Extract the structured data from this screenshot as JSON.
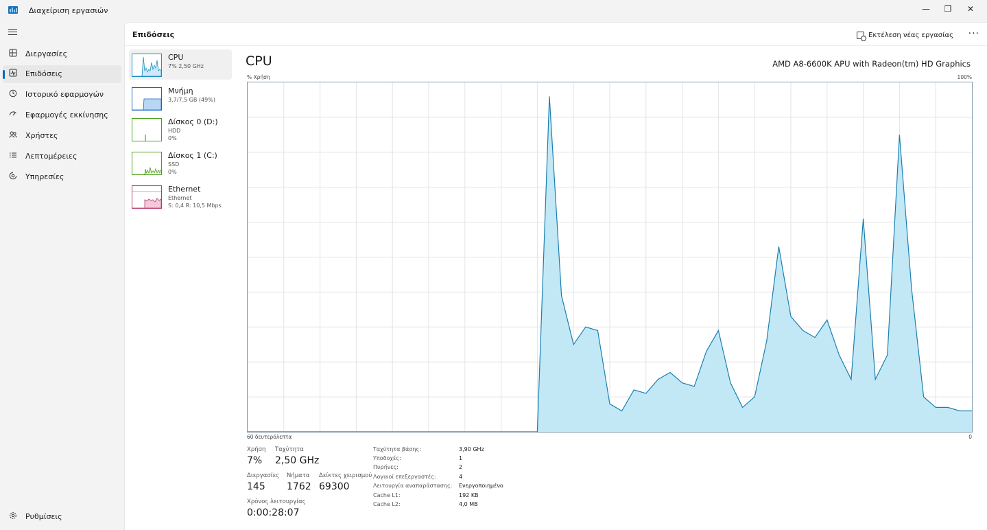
{
  "app": {
    "title": "Διαχείριση εργασιών",
    "window_controls": {
      "minimize": "—",
      "maximize": "❐",
      "close": "✕"
    }
  },
  "nav": {
    "items": [
      {
        "label": "Διεργασίες",
        "icon": "grid-icon"
      },
      {
        "label": "Επιδόσεις",
        "icon": "performance-icon",
        "active": true
      },
      {
        "label": "Ιστορικό εφαρμογών",
        "icon": "history-icon"
      },
      {
        "label": "Εφαρμογές εκκίνησης",
        "icon": "startup-icon"
      },
      {
        "label": "Χρήστες",
        "icon": "users-icon"
      },
      {
        "label": "Λεπτομέρειες",
        "icon": "details-icon"
      },
      {
        "label": "Υπηρεσίες",
        "icon": "services-icon"
      }
    ],
    "settings": {
      "label": "Ρυθμίσεις",
      "icon": "settings-icon"
    }
  },
  "header": {
    "title": "Επιδόσεις",
    "run_task_label": "Εκτέλεση νέας εργασίας",
    "more_label": "···"
  },
  "devices": [
    {
      "name": "CPU",
      "line1": "7% 2,50 GHz",
      "line2": "",
      "color": "#1b8fc7",
      "fill": "#cfe9f7",
      "active": true
    },
    {
      "name": "Μνήμη",
      "line1": "3,7/7,5 GB (49%)",
      "line2": "",
      "color": "#1b63c7",
      "fill": "#b8d7f4"
    },
    {
      "name": "Δίσκος 0 (D:)",
      "line1": "HDD",
      "line2": "0%",
      "color": "#4b9e1b",
      "fill": "#d6efc4"
    },
    {
      "name": "Δίσκος 1 (C:)",
      "line1": "SSD",
      "line2": "0%",
      "color": "#4b9e1b",
      "fill": "#d6efc4"
    },
    {
      "name": "Ethernet",
      "line1": "Ethernet",
      "line2": "S: 0,4 R: 10,5 Mbps",
      "color": "#b23a6b",
      "fill": "#f5c8d9"
    }
  ],
  "cpu": {
    "title": "CPU",
    "model": "AMD A8-6600K APU with Radeon(tm) HD Graphics",
    "y_label": "% Χρήση",
    "y_max_label": "100%",
    "x_left_label": "60 δευτερόλεπτα",
    "x_right_label": "0",
    "line_color": "#1b7fb0",
    "fill_color": "#c2e8f6",
    "grid_color": "#e3e3e3"
  },
  "chart_data": {
    "type": "area",
    "title": "",
    "xlabel": "60 δευτερόλεπτα",
    "ylabel": "% Χρήση",
    "xlim": [
      60,
      0
    ],
    "ylim": [
      0,
      100
    ],
    "grid": true,
    "series": [
      {
        "x": [
          60,
          59,
          58,
          57,
          56,
          55,
          54,
          53,
          52,
          51,
          50,
          49,
          48,
          47,
          46,
          45,
          44,
          43,
          42,
          41,
          40,
          39,
          38,
          37,
          36,
          35,
          34,
          33,
          32,
          31,
          30,
          29,
          28,
          27,
          26,
          25,
          24,
          23,
          22,
          21,
          20,
          19,
          18,
          17,
          16,
          15,
          14,
          13,
          12,
          11,
          10,
          9,
          8,
          7,
          6,
          5,
          4,
          3,
          2,
          1,
          0
        ],
        "values": [
          0,
          0,
          0,
          0,
          0,
          0,
          0,
          0,
          0,
          0,
          0,
          0,
          0,
          0,
          0,
          0,
          0,
          0,
          0,
          0,
          0,
          0,
          0,
          0,
          0,
          96,
          39,
          25,
          30,
          29,
          8,
          6,
          12,
          11,
          15,
          17,
          14,
          13,
          23,
          29,
          14,
          7,
          10,
          26,
          53,
          33,
          29,
          27,
          32,
          22,
          15,
          61,
          15,
          22,
          85,
          41,
          10,
          7,
          7,
          6,
          6
        ]
      }
    ]
  },
  "stats": {
    "utilization": {
      "label": "Χρήση",
      "value": "7%"
    },
    "speed": {
      "label": "Ταχύτητα",
      "value": "2,50 GHz"
    },
    "processes": {
      "label": "Διεργασίες",
      "value": "145"
    },
    "threads": {
      "label": "Νήματα",
      "value": "1762"
    },
    "handles": {
      "label": "Δείκτες χειρισμού",
      "value": "69300"
    },
    "uptime": {
      "label": "Χρόνος λειτουργίας",
      "value": "0:00:28:07"
    }
  },
  "specs": [
    {
      "label": "Ταχύτητα βάσης:",
      "value": "3,90 GHz"
    },
    {
      "label": "Υποδοχές:",
      "value": "1"
    },
    {
      "label": "Πυρήνες:",
      "value": "2"
    },
    {
      "label": "Λογικοί επεξεργαστές:",
      "value": "4"
    },
    {
      "label": "Λειτουργία αναπαράστασης:",
      "value": "Ενεργοποιημένο"
    },
    {
      "label": "Cache L1:",
      "value": "192 KB"
    },
    {
      "label": "Cache L2:",
      "value": "4,0 MB"
    }
  ]
}
